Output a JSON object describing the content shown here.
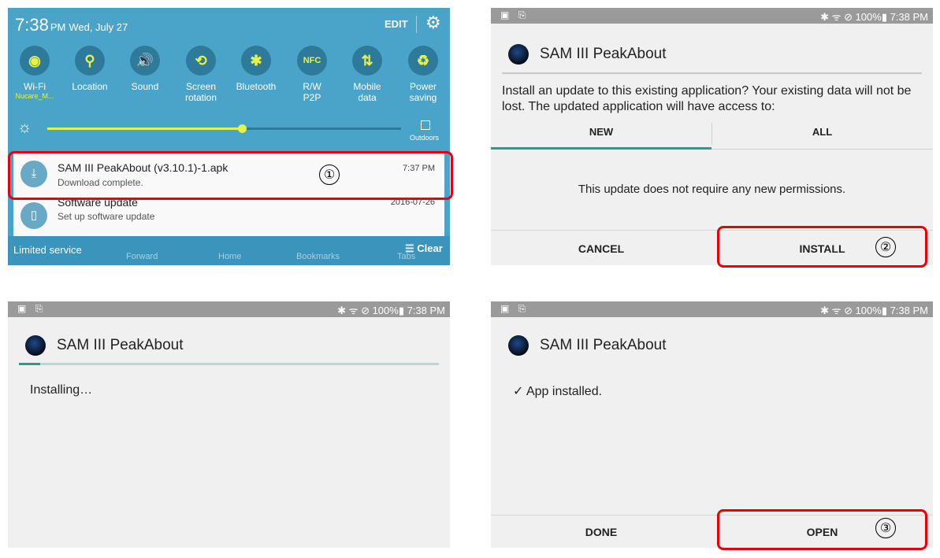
{
  "shade": {
    "time": "7:38",
    "ampm": "PM",
    "date": "Wed, July 27",
    "edit_label": "EDIT",
    "gear_icon": "gear-icon",
    "quick_settings": [
      {
        "line1": "Wi-Fi",
        "line2": "",
        "sub": "Nucare_M...",
        "glyph": "◉"
      },
      {
        "line1": "Location",
        "line2": "",
        "sub": "",
        "glyph": "⚲"
      },
      {
        "line1": "Sound",
        "line2": "",
        "sub": "",
        "glyph": "🔊"
      },
      {
        "line1": "Screen",
        "line2": "rotation",
        "sub": "",
        "glyph": "⟲"
      },
      {
        "line1": "Bluetooth",
        "line2": "",
        "sub": "",
        "glyph": "✱"
      },
      {
        "line1": "R/W",
        "line2": "P2P",
        "sub": "",
        "glyph": "NFC"
      },
      {
        "line1": "Mobile",
        "line2": "data",
        "sub": "",
        "glyph": "⇅"
      },
      {
        "line1": "Power",
        "line2": "saving",
        "sub": "",
        "glyph": "♻"
      }
    ],
    "brightness_level": 0.55,
    "outdoors_label": "Outdoors",
    "notifications": [
      {
        "title": "SAM III PeakAbout (v3.10.1)-1.apk",
        "subtitle": "Download complete.",
        "time": "7:37 PM",
        "icon": "download-icon"
      },
      {
        "title": "Software update",
        "subtitle": "Set up software update",
        "time": "2016-07-26",
        "icon": "phone-update-icon"
      }
    ],
    "limited_service": "Limited service",
    "clear_label": "Clear",
    "browser_ghost": [
      "Forward",
      "Home",
      "Bookmarks",
      "Tabs"
    ]
  },
  "status_bar": {
    "left_icons": "▣ ⎘",
    "right": "✱ ᯤ ⊘ 100%▮ 7:38 PM"
  },
  "app": {
    "name": "SAM III PeakAbout"
  },
  "install_dialog": {
    "message": "Install an update to this existing application? Your existing data will not be lost. The updated application will have access to:",
    "tabs": [
      "NEW",
      "ALL"
    ],
    "permissions_text": "This update does not require any new permissions.",
    "cancel_label": "CANCEL",
    "install_label": "INSTALL"
  },
  "installing": {
    "text": "Installing…",
    "progress": 0.05
  },
  "installed": {
    "check": "✓",
    "text": "App installed.",
    "done_label": "DONE",
    "open_label": "OPEN"
  },
  "steps": [
    "①",
    "②",
    "③"
  ]
}
